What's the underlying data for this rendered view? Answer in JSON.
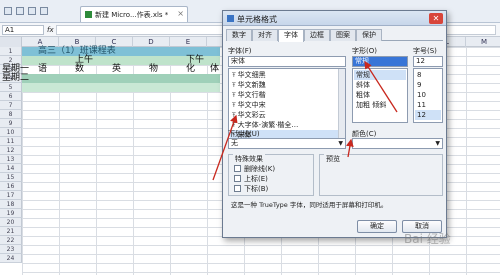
{
  "app": {
    "doc_tab_label": "新建 Micro...作表.xls *",
    "name_box": "A1",
    "formula_prefix": "fx",
    "columns": [
      "A",
      "B",
      "C",
      "D",
      "E",
      "F",
      "G",
      "H",
      "I",
      "J",
      "K",
      "L",
      "M"
    ],
    "rows": [
      "1",
      "2",
      "3",
      "4",
      "5",
      "6",
      "7",
      "8",
      "9",
      "10",
      "11",
      "12",
      "13",
      "14",
      "15",
      "16",
      "17",
      "18",
      "19",
      "20",
      "21",
      "22",
      "23",
      "24"
    ]
  },
  "sheet": {
    "title_cell": "高三（1）班课程表",
    "morning": "上午",
    "afternoon": "下午",
    "day_mon": "星期一",
    "day_tue": "星期二",
    "subjects": [
      "语",
      "数",
      "英",
      "物",
      "化",
      "体"
    ],
    "band_color": "#a9d5b6"
  },
  "dialog": {
    "title": "单元格格式",
    "close": "✕",
    "tabs": [
      "数字",
      "对齐",
      "字体",
      "边框",
      "图案",
      "保护"
    ],
    "active_tab": "字体",
    "font_label": "字体(F)",
    "font_value": "宋体",
    "font_list": [
      "华文细黑",
      "华文新魏",
      "华文行楷",
      "华文中宋",
      "华文彩云",
      "大字体-演繁·楷全…",
      "宋体"
    ],
    "style_label": "字形(O)",
    "style_value": "常规",
    "style_list": [
      "常规",
      "斜体",
      "粗体",
      "加粗 倾斜"
    ],
    "size_label": "字号(S)",
    "size_value": "12",
    "size_list": [
      "8",
      "9",
      "10",
      "11",
      "12"
    ],
    "underline_label": "下划线(U)",
    "underline_value": "无",
    "color_label": "颜色(C)",
    "effects_label": "特殊效果",
    "effects": [
      "删除线(K)",
      "上标(E)",
      "下标(B)"
    ],
    "preview_label": "预览",
    "description": "这是一种 TrueType 字体，同时适用于屏幕和打印机。",
    "ok": "确定",
    "cancel": "取消"
  },
  "watermark": "Bai 经验"
}
